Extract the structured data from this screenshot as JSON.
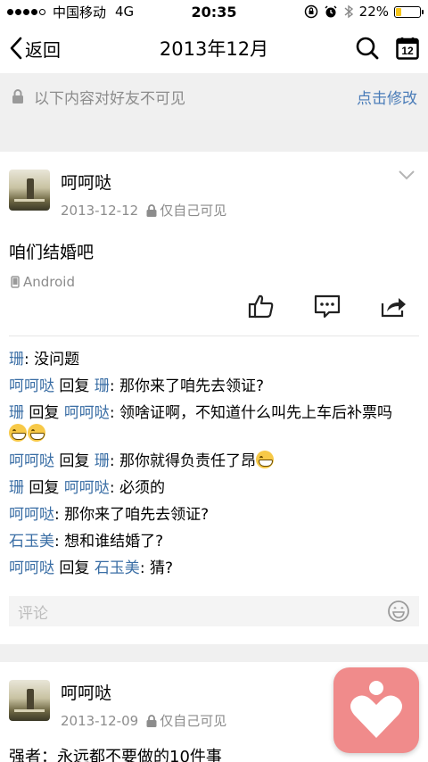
{
  "status_bar": {
    "carrier": "中国移动",
    "network": "4G",
    "time": "20:35",
    "battery_percent": "22%",
    "battery_level": 0.22
  },
  "nav": {
    "back_label": "返回",
    "title": "2013年12月",
    "calendar_day": "12"
  },
  "privacy": {
    "text": "以下内容对好友不可见",
    "action": "点击修改"
  },
  "posts": [
    {
      "author": "呵呵哒",
      "date": "2013-12-12",
      "visibility": "仅自己可见",
      "text": "咱们结婚吧",
      "device": "Android",
      "comments": [
        {
          "name": "珊",
          "sep": ": ",
          "text": "没问题"
        },
        {
          "name": "呵呵哒",
          "reply_word": " 回复 ",
          "to": "珊",
          "sep": ": ",
          "text": "那你来了咱先去领证?"
        },
        {
          "name": "珊",
          "reply_word": " 回复 ",
          "to": "呵呵哒",
          "sep": ": ",
          "text": "领啥证啊，不知道什么叫先上车后补票吗"
        },
        {
          "name": "呵呵哒",
          "reply_word": " 回复 ",
          "to": "珊",
          "sep": ": ",
          "text": "那你就得负责任了昂"
        },
        {
          "name": "珊",
          "reply_word": " 回复 ",
          "to": "呵呵哒",
          "sep": ": ",
          "text": "必须的"
        },
        {
          "name": "呵呵哒",
          "sep": ": ",
          "text": "那你来了咱先去领证?"
        },
        {
          "name": "石玉美",
          "sep": ": ",
          "text": "想和谁结婚了?"
        },
        {
          "name": "呵呵哒",
          "reply_word": " 回复 ",
          "to": "石玉美",
          "sep": ": ",
          "text": "猜?"
        }
      ],
      "comment_placeholder": "评论"
    },
    {
      "author": "呵呵哒",
      "date": "2013-12-09",
      "visibility": "仅自己可见",
      "text": "强者：永远都不要做的10件事"
    }
  ],
  "colors": {
    "link_blue": "#3a6ea5",
    "action_blue": "#4a7cb8",
    "float_button": "#f08b8b"
  }
}
